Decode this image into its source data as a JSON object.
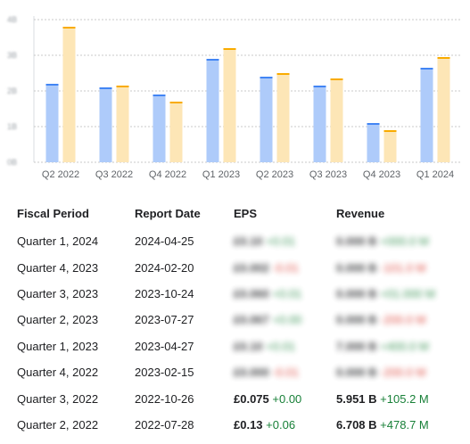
{
  "chart_data": {
    "type": "bar",
    "categories": [
      "Q2 2022",
      "Q3 2022",
      "Q4 2022",
      "Q1 2023",
      "Q2 2023",
      "Q3 2023",
      "Q4 2023",
      "Q1 2024"
    ],
    "ylim": [
      0,
      4
    ],
    "y_tick_labels": [
      "0B",
      "1B",
      "2B",
      "3B",
      "4B"
    ],
    "series": [
      {
        "values": [
          2.2,
          2.1,
          1.9,
          2.9,
          2.4,
          2.15,
          1.1,
          2.65
        ],
        "color": "#aecbfa",
        "cap_color": "#4285f4"
      },
      {
        "values": [
          3.8,
          2.15,
          1.7,
          3.2,
          2.5,
          2.35,
          0.9,
          2.95
        ],
        "color": "#fde6b6",
        "cap_color": "#f9ab00"
      }
    ],
    "grid": true
  },
  "table": {
    "headers": [
      "Fiscal Period",
      "Report Date",
      "EPS",
      "Revenue"
    ],
    "rows": [
      {
        "period": "Quarter 1, 2024",
        "date": "2024-04-25",
        "eps": "£0.10",
        "eps_change": "+0.01",
        "eps_dir": "pos",
        "revenue": "0.000 B",
        "revenue_change": "+000.0 M",
        "rev_dir": "pos",
        "hidden": true
      },
      {
        "period": "Quarter 4, 2023",
        "date": "2024-02-20",
        "eps": "£0.002",
        "eps_change": "-0.01",
        "eps_dir": "neg",
        "revenue": "0.000 B",
        "revenue_change": "-101.0 M",
        "rev_dir": "neg",
        "hidden": true
      },
      {
        "period": "Quarter 3, 2023",
        "date": "2023-10-24",
        "eps": "£0.060",
        "eps_change": "+0.01",
        "eps_dir": "pos",
        "revenue": "0.000 B",
        "revenue_change": "+01.000 M",
        "rev_dir": "pos",
        "hidden": true
      },
      {
        "period": "Quarter 2, 2023",
        "date": "2023-07-27",
        "eps": "£0.067",
        "eps_change": "+0.00",
        "eps_dir": "pos",
        "revenue": "0.000 B",
        "revenue_change": "-200.0 M",
        "rev_dir": "neg",
        "hidden": true
      },
      {
        "period": "Quarter 1, 2023",
        "date": "2023-04-27",
        "eps": "£0.10",
        "eps_change": "+0.01",
        "eps_dir": "pos",
        "revenue": "7.000 B",
        "revenue_change": "+400.0 M",
        "rev_dir": "pos",
        "hidden": true
      },
      {
        "period": "Quarter 4, 2022",
        "date": "2023-02-15",
        "eps": "£0.000",
        "eps_change": "-0.01",
        "eps_dir": "neg",
        "revenue": "0.000 B",
        "revenue_change": "-200.0 M",
        "rev_dir": "neg",
        "hidden": true
      },
      {
        "period": "Quarter 3, 2022",
        "date": "2022-10-26",
        "eps": "£0.075",
        "eps_change": "+0.00",
        "eps_dir": "pos",
        "revenue": "5.951 B",
        "revenue_change": "+105.2 M",
        "rev_dir": "pos",
        "hidden": false
      },
      {
        "period": "Quarter 2, 2022",
        "date": "2022-07-28",
        "eps": "£0.13",
        "eps_change": "+0.06",
        "eps_dir": "pos",
        "revenue": "6.708 B",
        "revenue_change": "+478.7 M",
        "rev_dir": "pos",
        "hidden": false
      }
    ]
  }
}
